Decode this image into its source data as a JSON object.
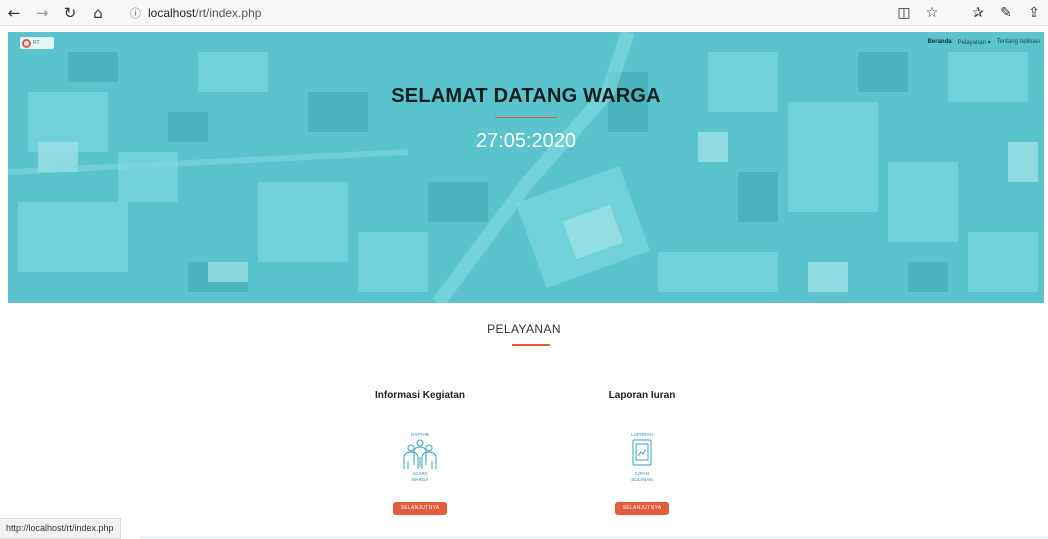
{
  "browser": {
    "back_icon": "←",
    "forward_icon": "→",
    "refresh_icon": "↻",
    "home_icon": "⌂",
    "info_icon": "ⓘ",
    "url_host": "localhost",
    "url_path": "/rt/index.php",
    "reading_view_icon": "◫",
    "favorite_icon": "☆",
    "favorites_hub_icon": "✰",
    "pen_icon": "✎",
    "share_icon": "⇪"
  },
  "header": {
    "logo_text": "RT",
    "nav": {
      "beranda": "Beranda",
      "pelayanan": "Pelayanan ▾",
      "tentang": "Tentang Aplikasi"
    }
  },
  "hero": {
    "title": "SELAMAT DATANG WARGA",
    "date": "27:05:2020"
  },
  "services": {
    "title": "PELAYANAN",
    "cards": [
      {
        "title": "Informasi Kegiatan",
        "icon_top": "DAFTAR",
        "icon_bottom1": "ACARA",
        "icon_bottom2": "WARGA",
        "button": "SELANJUTNYA"
      },
      {
        "title": "Laporan Iuran",
        "icon_top": "LAPORAN",
        "icon_bottom1": "IURAN",
        "icon_bottom2": "BULANAN",
        "button": "SELANJUTNYA"
      }
    ]
  },
  "status": {
    "url": "http://localhost/rt/index.php"
  },
  "colors": {
    "accent": "#e35a3c",
    "hero_tint": "#5cc6cf"
  }
}
